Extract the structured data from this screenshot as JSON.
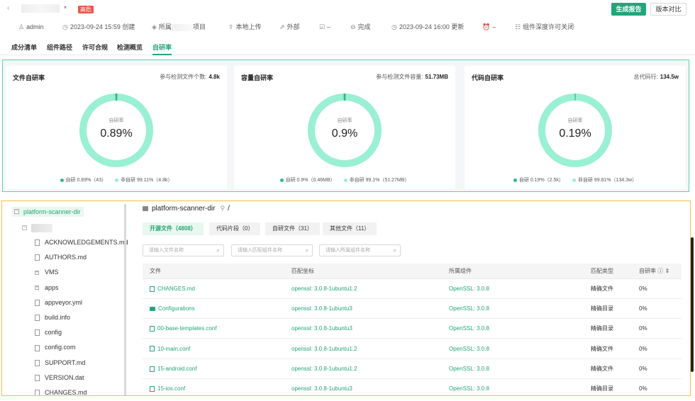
{
  "header": {
    "back_icon": "chevron-left-icon",
    "risk_badge": "高危",
    "generate_report": "生成报告",
    "compare_version": "版本对比"
  },
  "meta": {
    "user": "admin",
    "created": "2023-09-24 15:59 创建",
    "owner_prefix": "所属",
    "project": "项目",
    "upload": "本地上传",
    "source": "外部",
    "check_dash": "–",
    "status": "完成",
    "updated": "2023-09-24 16:00 更新",
    "alarm_dash": "–",
    "license": "组件深度许可关闭"
  },
  "tabs": [
    "成分清单",
    "组件路径",
    "许可合规",
    "检测概览",
    "自研率"
  ],
  "active_tab": "自研率",
  "colors": {
    "accent": "#23a47a",
    "donut_main": "#9af0d2",
    "donut_self": "#2eb886",
    "risk": "#e7554b"
  },
  "stats": [
    {
      "title": "文件自研率",
      "meta_label": "参与检测文件个数:",
      "meta_value": "4.8k",
      "center_label": "自研率",
      "center_value": "0.89%",
      "fraction": 0.0089,
      "legend_self": "自研 0.89%（43）",
      "legend_other": "非自研 99.11%（4.8k）"
    },
    {
      "title": "容量自研率",
      "meta_label": "参与检测文件容量:",
      "meta_value": "51.73MB",
      "center_label": "自研率",
      "center_value": "0.9%",
      "fraction": 0.009,
      "legend_self": "自研 0.9%（0.46MB）",
      "legend_other": "非自研 99.1%（51.27MB）"
    },
    {
      "title": "代码自研率",
      "meta_label": "总代码行:",
      "meta_value": "134.5w",
      "center_label": "自研率",
      "center_value": "0.19%",
      "fraction": 0.0019,
      "legend_self": "自研 0.19%（2.5k）",
      "legend_other": "非自研 99.81%（134.3w）"
    }
  ],
  "tree": {
    "root": "platform-scanner-dir",
    "items": [
      {
        "label": "ACKNOWLEDGEMENTS.md",
        "type": "file"
      },
      {
        "label": "AUTHORS.md",
        "type": "file"
      },
      {
        "label": "VMS",
        "type": "folder"
      },
      {
        "label": "apps",
        "type": "folder"
      },
      {
        "label": "appveyor.yml",
        "type": "file"
      },
      {
        "label": "build.info",
        "type": "file"
      },
      {
        "label": "config",
        "type": "file"
      },
      {
        "label": "config.com",
        "type": "file"
      },
      {
        "label": "SUPPORT.md",
        "type": "file"
      },
      {
        "label": "VERSION.dat",
        "type": "file"
      },
      {
        "label": "CHANGES.md",
        "type": "file"
      }
    ]
  },
  "main": {
    "path_title": "platform-scanner-dir",
    "path_sep": "/",
    "file_tabs": [
      "开源文件（4808）",
      "代码片段（0）",
      "自研文件（31）",
      "其他文件（11）"
    ],
    "filters": [
      "请输入文件名称",
      "请输入匹配组件名称",
      "请输入所属组件名称"
    ],
    "columns": [
      "文件",
      "匹配坐标",
      "所属组件",
      "匹配类型",
      "自研率"
    ],
    "rows": [
      {
        "file": "CHANGES.md",
        "type": "file",
        "coord": "openssl: 3.0.8-1ubuntu1.2",
        "component": "OpenSSL: 3.0.8",
        "match": "精确文件",
        "rate": "0%"
      },
      {
        "file": "Configurations",
        "type": "folder",
        "coord": "openssl: 3.0.8-1ubuntu3",
        "component": "OpenSSL: 3.0.8",
        "match": "精确目录",
        "rate": "0%"
      },
      {
        "file": "00-base-templates.conf",
        "type": "file",
        "coord": "openssl: 3.0.8-1ubuntu3",
        "component": "OpenSSL: 3.0.8",
        "match": "精确目录",
        "rate": "0%"
      },
      {
        "file": "10-main.conf",
        "type": "file",
        "coord": "openssl: 3.0.8-1ubuntu1.2",
        "component": "OpenSSL: 3.0.8",
        "match": "精确文件",
        "rate": "0%"
      },
      {
        "file": "15-android.conf",
        "type": "file",
        "coord": "openssl: 3.0.8-1ubuntu1.2",
        "component": "OpenSSL: 3.0.8",
        "match": "精确文件",
        "rate": "0%"
      },
      {
        "file": "15-ios.conf",
        "type": "file",
        "coord": "openssl: 3.0.8-1ubuntu3",
        "component": "OpenSSL: 3.0.8",
        "match": "精确目录",
        "rate": "0%"
      }
    ]
  }
}
